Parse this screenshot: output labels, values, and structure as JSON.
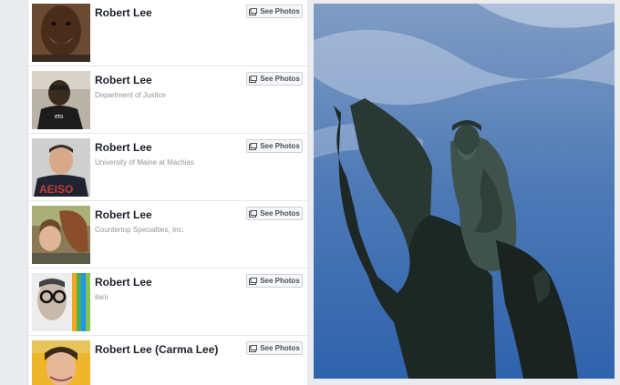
{
  "results": [
    {
      "name": "Robert Lee",
      "subtitle": "",
      "button": "See Photos"
    },
    {
      "name": "Robert Lee",
      "subtitle": "Department of Justice",
      "button": "See Photos"
    },
    {
      "name": "Robert Lee",
      "subtitle": "University of Maine at Machias",
      "button": "See Photos"
    },
    {
      "name": "Robert Lee",
      "subtitle": "Countertop Specialties, Inc.",
      "button": "See Photos"
    },
    {
      "name": "Robert Lee",
      "subtitle": "ilani",
      "button": "See Photos"
    },
    {
      "name": "Robert Lee (Carma Lee)",
      "subtitle": "",
      "button": "See Photos"
    }
  ],
  "icons": {
    "button_icon": "photo-icon"
  }
}
